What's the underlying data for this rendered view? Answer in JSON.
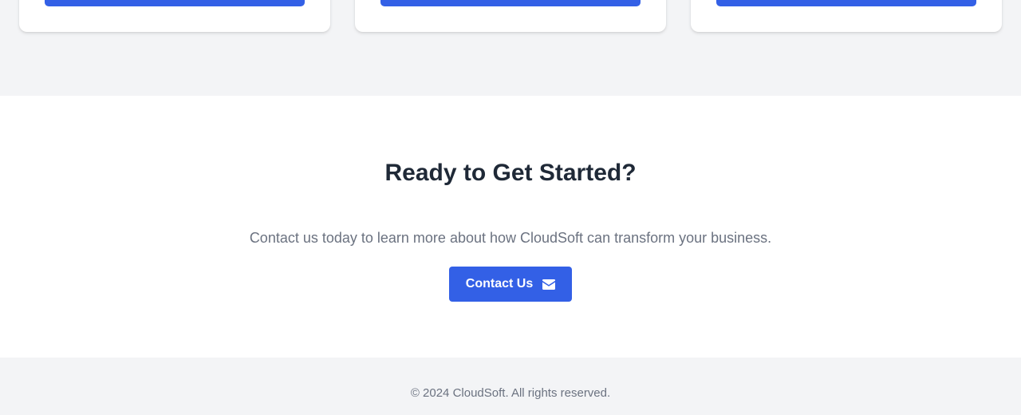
{
  "cta": {
    "title": "Ready to Get Started?",
    "text": "Contact us today to learn more about how CloudSoft can transform your business.",
    "button_label": "Contact Us",
    "button_icon": "envelope-icon"
  },
  "footer": {
    "copyright": "© 2024 CloudSoft. All rights reserved."
  },
  "colors": {
    "accent": "#3360e6",
    "heading": "#1f2937",
    "muted": "#6b7280",
    "section_gray": "#f3f4f6"
  }
}
